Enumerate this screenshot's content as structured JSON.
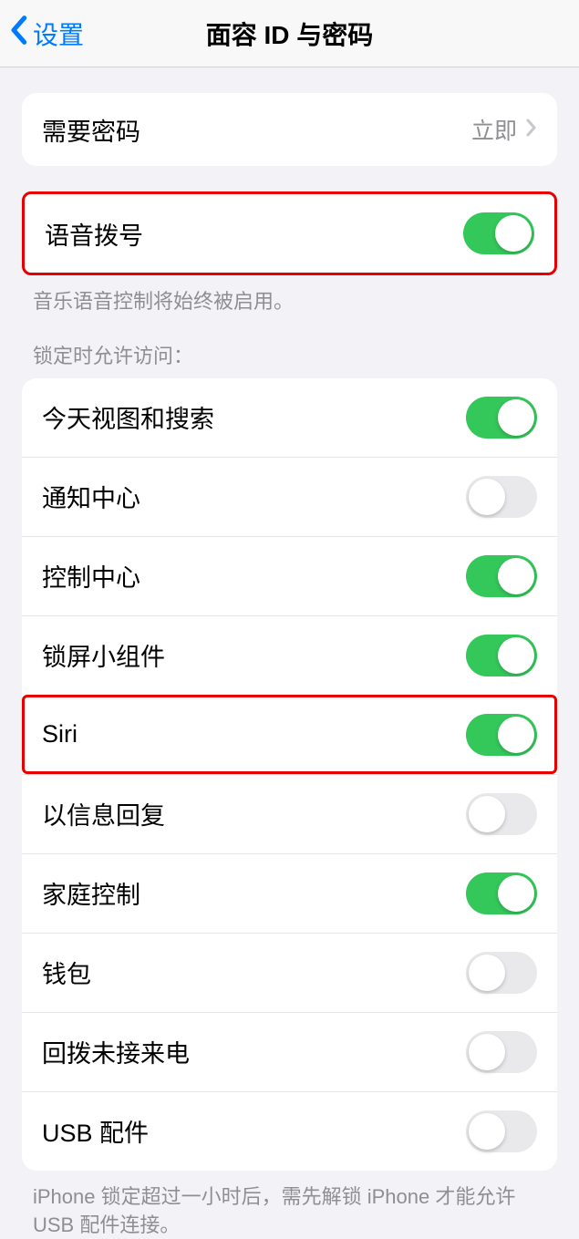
{
  "nav": {
    "back_label": "设置",
    "title": "面容 ID 与密码"
  },
  "passcode_group": {
    "require_label": "需要密码",
    "require_value": "立即"
  },
  "voice_group": {
    "voice_dial_label": "语音拨号",
    "voice_dial_on": true,
    "footer": "音乐语音控制将始终被启用。"
  },
  "lock_access": {
    "header": "锁定时允许访问：",
    "items": [
      {
        "label": "今天视图和搜索",
        "on": true,
        "highlight": false
      },
      {
        "label": "通知中心",
        "on": false,
        "highlight": false
      },
      {
        "label": "控制中心",
        "on": true,
        "highlight": false
      },
      {
        "label": "锁屏小组件",
        "on": true,
        "highlight": false
      },
      {
        "label": "Siri",
        "on": true,
        "highlight": true
      },
      {
        "label": "以信息回复",
        "on": false,
        "highlight": false
      },
      {
        "label": "家庭控制",
        "on": true,
        "highlight": false
      },
      {
        "label": "钱包",
        "on": false,
        "highlight": false
      },
      {
        "label": "回拨未接来电",
        "on": false,
        "highlight": false
      },
      {
        "label": "USB 配件",
        "on": false,
        "highlight": false
      }
    ],
    "footer": "iPhone 锁定超过一小时后，需先解锁 iPhone 才能允许USB 配件连接。"
  }
}
